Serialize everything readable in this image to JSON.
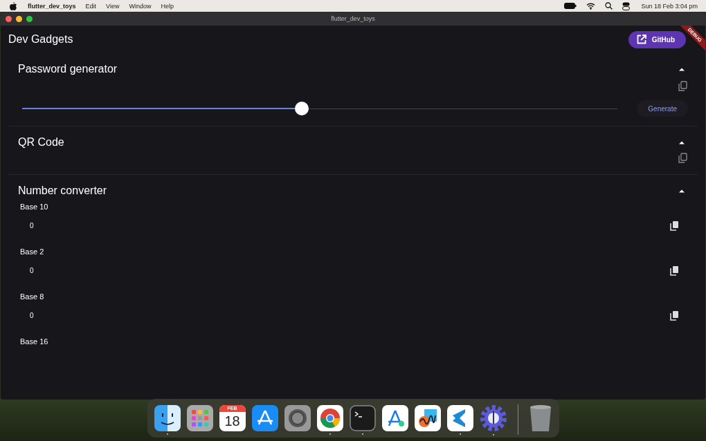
{
  "menu_bar": {
    "app_name": "flutter_dev_toys",
    "menus": [
      "Edit",
      "View",
      "Window",
      "Help"
    ],
    "clock": "Sun 18 Feb  3:04 pm"
  },
  "window": {
    "title": "flutter_dev_toys"
  },
  "app_bar": {
    "title": "Dev Gadgets",
    "github_button": "GitHub",
    "debug_banner": "DEBUG"
  },
  "password_generator": {
    "title": "Password generator",
    "expanded": true,
    "length_slider": {
      "level": 0.47
    },
    "generate_button": "Generate"
  },
  "qr_code": {
    "title": "QR Code",
    "expanded": true
  },
  "number_converter": {
    "title": "Number converter",
    "expanded": true,
    "fields": [
      {
        "label": "Base 10",
        "value": "0"
      },
      {
        "label": "Base 2",
        "value": "0"
      },
      {
        "label": "Base 8",
        "value": "0"
      },
      {
        "label": "Base 16"
      }
    ]
  },
  "dock": {
    "items": [
      {
        "kind": "finder",
        "running": true
      },
      {
        "kind": "launchpad",
        "running": false
      },
      {
        "kind": "calendar",
        "running": false,
        "month": "FEB",
        "day": "18"
      },
      {
        "kind": "appstore",
        "running": false
      },
      {
        "kind": "settings",
        "running": false
      },
      {
        "kind": "chrome",
        "running": true
      },
      {
        "kind": "terminal",
        "running": true
      },
      {
        "kind": "xcode",
        "running": false
      },
      {
        "kind": "freeform",
        "running": false
      },
      {
        "kind": "vscode",
        "running": true
      },
      {
        "kind": "gear",
        "running": true
      },
      {
        "kind": "trash",
        "running": false
      }
    ]
  }
}
